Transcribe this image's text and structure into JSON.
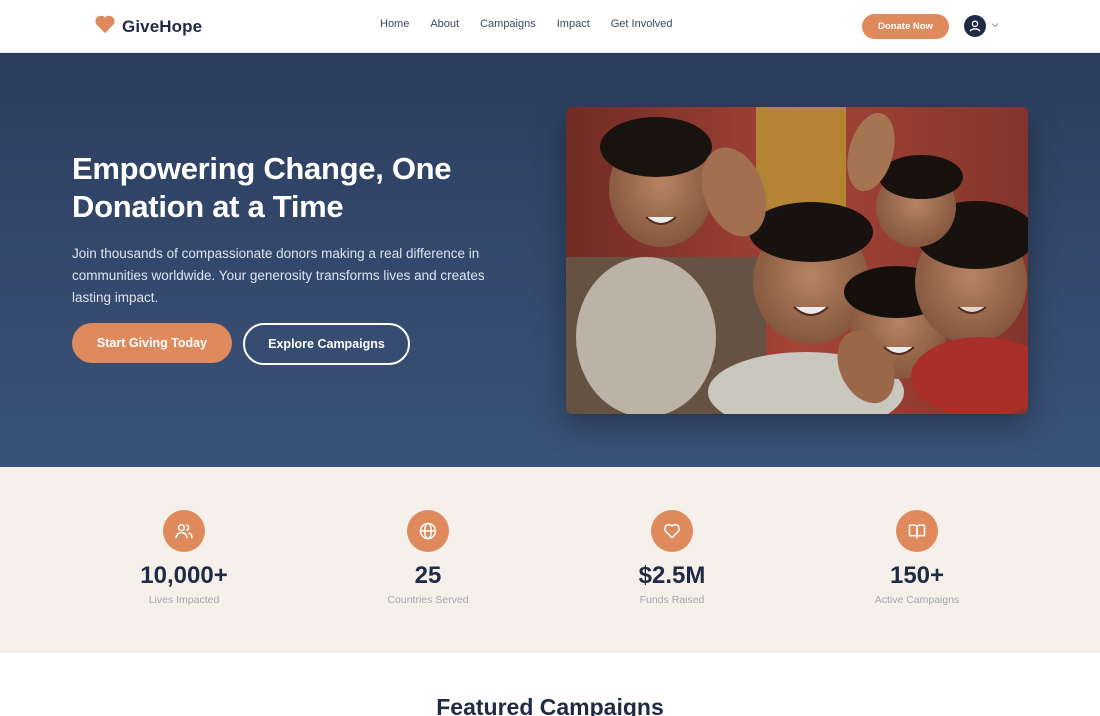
{
  "nav": {
    "brand": "GiveHope",
    "links": [
      "Home",
      "About",
      "Campaigns",
      "Impact",
      "Get Involved"
    ],
    "donate_label": "Donate Now",
    "brand_color": "#df8a5c"
  },
  "hero": {
    "title": "Empowering Change, One Donation at a Time",
    "subtitle": "Join thousands of compassionate donors making a real difference in communities worldwide. Your generosity transforms lives and creates lasting impact.",
    "primary_cta": "Start Giving Today",
    "secondary_cta": "Explore Campaigns",
    "image": "smiling-children-photo"
  },
  "stats": [
    {
      "icon": "users-icon",
      "value": "10,000+",
      "label": "Lives Impacted"
    },
    {
      "icon": "globe-icon",
      "value": "25",
      "label": "Countries Served"
    },
    {
      "icon": "heart-icon",
      "value": "$2.5M",
      "label": "Funds Raised"
    },
    {
      "icon": "book-icon",
      "value": "150+",
      "label": "Active Campaigns"
    }
  ],
  "featured": {
    "title": "Featured Campaigns"
  }
}
